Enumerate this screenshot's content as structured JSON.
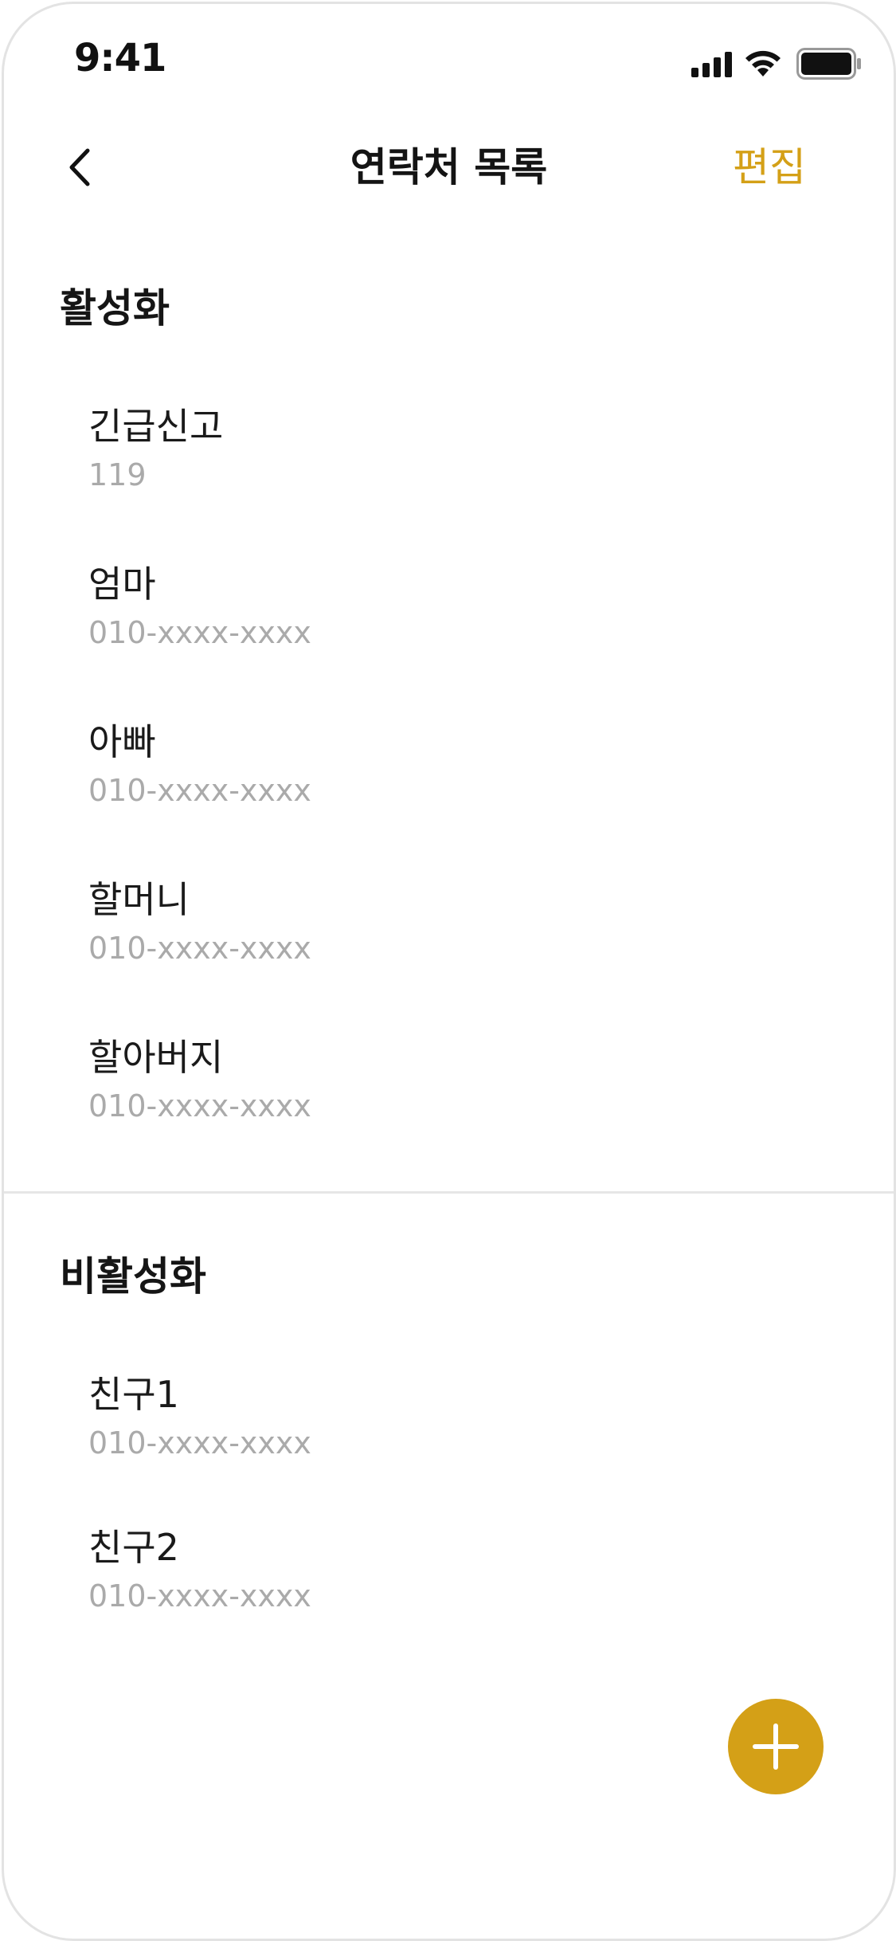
{
  "status_bar": {
    "time": "9:41"
  },
  "nav": {
    "title": "연락처 목록",
    "edit_label": "편집",
    "back_icon": "chevron-left-icon"
  },
  "active_section": {
    "title": "활성화",
    "contacts": [
      {
        "name": "긴급신고",
        "phone": "119"
      },
      {
        "name": "엄마",
        "phone": "010-xxxx-xxxx"
      },
      {
        "name": "아빠",
        "phone": "010-xxxx-xxxx"
      },
      {
        "name": "할머니",
        "phone": "010-xxxx-xxxx"
      },
      {
        "name": "할아버지",
        "phone": "010-xxxx-xxxx"
      }
    ]
  },
  "inactive_section": {
    "title": "비활성화",
    "contacts": [
      {
        "name": "친구1",
        "phone": "010-xxxx-xxxx"
      },
      {
        "name": "친구2",
        "phone": "010-xxxx-xxxx"
      }
    ]
  },
  "fab": {
    "icon": "plus-icon"
  },
  "colors": {
    "accent": "#D4A017",
    "text_primary": "#1a1a1a",
    "text_secondary": "#aaaaaa",
    "divider": "#e6e6e6"
  }
}
